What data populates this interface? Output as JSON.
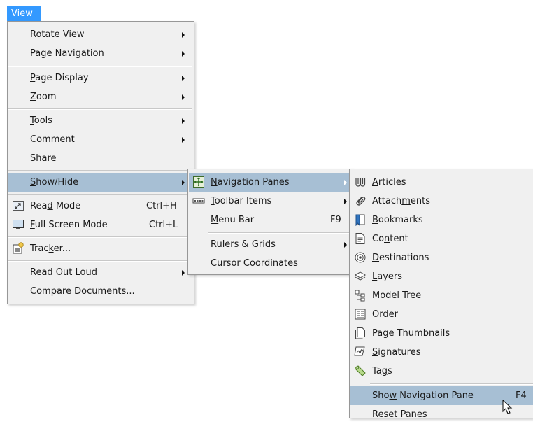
{
  "menubar": {
    "view": "View"
  },
  "view_menu": {
    "rotate_view": [
      "Rotate ",
      "V",
      "iew"
    ],
    "page_navigation": [
      "Page ",
      "N",
      "avigation"
    ],
    "page_display": [
      "",
      "P",
      "age Display"
    ],
    "zoom": [
      "",
      "Z",
      "oom"
    ],
    "tools": [
      "",
      "T",
      "ools"
    ],
    "comment": [
      "Co",
      "m",
      "ment"
    ],
    "share": "Share",
    "show_hide": [
      "",
      "S",
      "how/Hide"
    ],
    "read_mode": [
      "Rea",
      "d",
      " Mode"
    ],
    "read_mode_shortcut": "Ctrl+H",
    "full_screen": [
      "",
      "F",
      "ull Screen Mode"
    ],
    "full_screen_shortcut": "Ctrl+L",
    "tracker": [
      "Trac",
      "k",
      "er..."
    ],
    "read_out_loud": [
      "Re",
      "a",
      "d Out Loud"
    ],
    "compare": [
      "",
      "C",
      "ompare Documents..."
    ]
  },
  "showhide_menu": {
    "navigation_panes": [
      "",
      "N",
      "avigation Panes"
    ],
    "toolbar_items": [
      "",
      "T",
      "oolbar Items"
    ],
    "menu_bar": [
      "",
      "M",
      "enu Bar"
    ],
    "menu_bar_shortcut": "F9",
    "rulers_grids": [
      "",
      "R",
      "ulers & Grids"
    ],
    "cursor_coordinates": [
      "C",
      "u",
      "rsor Coordinates"
    ]
  },
  "navpanes_menu": {
    "articles": [
      "",
      "A",
      "rticles"
    ],
    "attachments": [
      "Attach",
      "m",
      "ents"
    ],
    "bookmarks": [
      "",
      "B",
      "ookmarks"
    ],
    "content": [
      "Co",
      "n",
      "tent"
    ],
    "destinations": [
      "",
      "D",
      "estinations"
    ],
    "layers": [
      "",
      "L",
      "ayers"
    ],
    "model_tree": [
      "Model Tr",
      "e",
      "e"
    ],
    "order": [
      "",
      "O",
      "rder"
    ],
    "page_thumbnails": [
      "",
      "P",
      "age Thumbnails"
    ],
    "signatures": [
      "",
      "S",
      "ignatures"
    ],
    "tags": [
      "Ta",
      "g",
      "s"
    ],
    "show_navigation_pane": [
      "Sho",
      "w",
      " Navigation Pane"
    ],
    "show_navigation_pane_shortcut": "F4",
    "reset_panes": "Reset Panes"
  }
}
